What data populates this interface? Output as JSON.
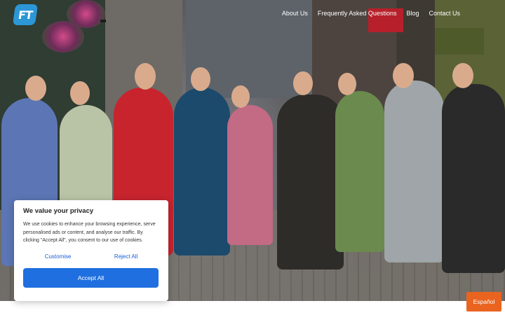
{
  "brand": {
    "logo_text": "FT",
    "accent": "#2b97d6"
  },
  "nav": {
    "items": [
      {
        "label": "About Us"
      },
      {
        "label": "Frequently Asked Questions"
      },
      {
        "label": "Blog"
      },
      {
        "label": "Contact Us"
      }
    ]
  },
  "hero": {
    "image_alt": "Group photo of tour participants on a cobbled street"
  },
  "cookie_banner": {
    "title": "We value your privacy",
    "text": "We use cookies to enhance your browsing experience, serve personalised ads or content, and analyse our traffic. By clicking \"Accept All\", you consent to our use of cookies.",
    "customise_label": "Customise",
    "reject_label": "Reject All",
    "accept_label": "Accept All",
    "accept_color": "#1f6fe0"
  },
  "language_button": {
    "label": "Español",
    "color": "#ea6420"
  }
}
